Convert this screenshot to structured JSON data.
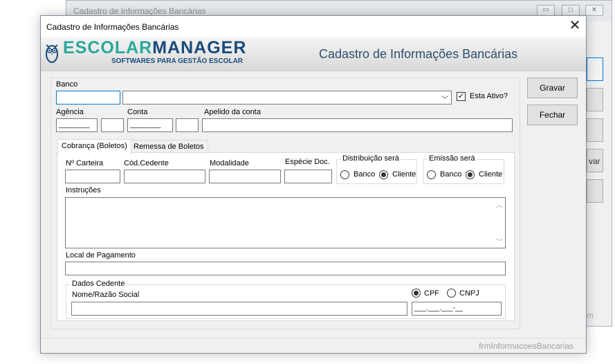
{
  "background_window": {
    "title": "Cadastro de Informações Bancárias",
    "button_partial_label": "var",
    "footer_partial": "m"
  },
  "dialog": {
    "title": "Cadastro de Informações Bancárias",
    "close_glyph": "✕"
  },
  "banner": {
    "logo_part1": "ESCOLAR",
    "logo_part2": "MANAGER",
    "logo_sub": "SOFTWARES PARA GESTÃO ESCOLAR",
    "title": "Cadastro de Informações Bancárias"
  },
  "form": {
    "banco_label": "Banco",
    "banco_code": "",
    "banco_select": "",
    "esta_ativo_label": "Esta Ativo?",
    "esta_ativo_checked": true,
    "agencia_label": "Agência",
    "agencia_mask": "________",
    "agencia_dv": "",
    "conta_label": "Conta",
    "conta_mask": "________",
    "conta_dv": "",
    "apelido_label": "Apelido da conta",
    "apelido_value": ""
  },
  "tabs": [
    {
      "label": "Cobrança (Boletos)",
      "active": true
    },
    {
      "label": "Remessa de Boletos",
      "active": false
    }
  ],
  "cobranca": {
    "carteira_label": "Nº Carteira",
    "cod_cedente_label": "Cód.Cedente",
    "modalidade_label": "Modalidade",
    "especie_label": "Espécie Doc.",
    "distribuicao_title": "Distribuição será",
    "emissao_title": "Emissão será",
    "opt_banco": "Banco",
    "opt_cliente": "Cliente",
    "distribuicao_selected": "Cliente",
    "emissao_selected": "Cliente",
    "instrucoes_label": "Instruções",
    "local_pagamento_label": "Local de Pagamento",
    "dados_cedente_title": "Dados Cedente",
    "nome_label": "Nome/Razão Social",
    "cpf_label": "CPF",
    "cnpj_label": "CNPJ",
    "doc_selected": "CPF",
    "doc_mask": "___.___.___-__"
  },
  "buttons": {
    "gravar": "Gravar",
    "fechar": "Fechar"
  },
  "status": {
    "form_name": "frmInformacoesBancarias"
  },
  "colors": {
    "logo_teal": "#2aa89a",
    "logo_navy": "#1a4a78",
    "banner_title": "#2d4f6e",
    "focus_border": "#0078d7"
  }
}
